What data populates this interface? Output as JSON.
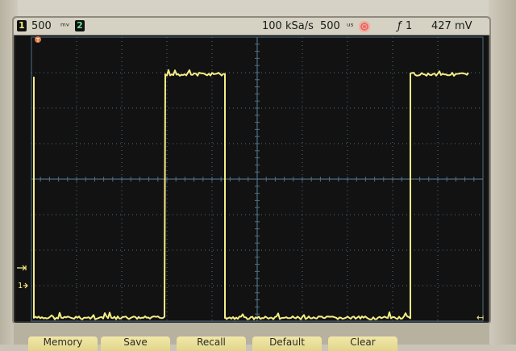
{
  "status_bar": {
    "ch1_number": "1",
    "ch1_scale": "500",
    "ch1_unit_glyph": "ᵐᵛ",
    "ch2_number": "2",
    "sample_rate": "100 kSa/s",
    "time_div": "500",
    "time_unit_glyph": "ᵘˢ",
    "trigger_source": "1",
    "trigger_level": "427 mV",
    "trigger_edge_glyph": "ƒ"
  },
  "markers": {
    "trigger_position": "T",
    "ch1_level": "1",
    "trigger_level_arrow": "↤"
  },
  "softkeys": [
    "Memory",
    "Save",
    "Recall",
    "Default",
    "Clear"
  ],
  "colors": {
    "trace_ch1": "#f5ee86",
    "graticule": "#4f6f86",
    "status_bar_bg": "#d5d2c3",
    "run_indicator": "#e27063",
    "screen_bg": "#121212",
    "softkey_bg": "#e8dc92"
  }
}
